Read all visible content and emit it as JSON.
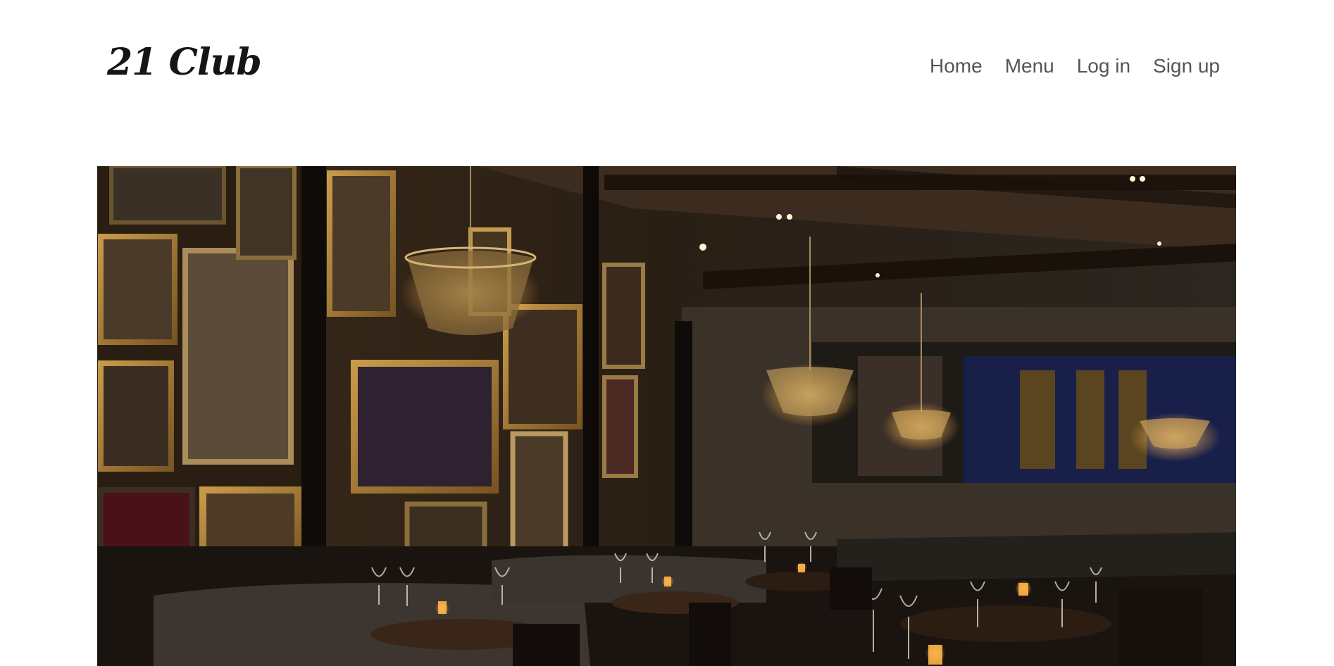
{
  "brand": {
    "name": "21 Club"
  },
  "nav": {
    "items": [
      {
        "label": "Home"
      },
      {
        "label": "Menu"
      },
      {
        "label": "Log in"
      },
      {
        "label": "Sign up"
      }
    ]
  },
  "hero": {
    "alt": "Restaurant dining room interior"
  },
  "colors": {
    "nav_text": "#555555",
    "logo": "#151515"
  }
}
